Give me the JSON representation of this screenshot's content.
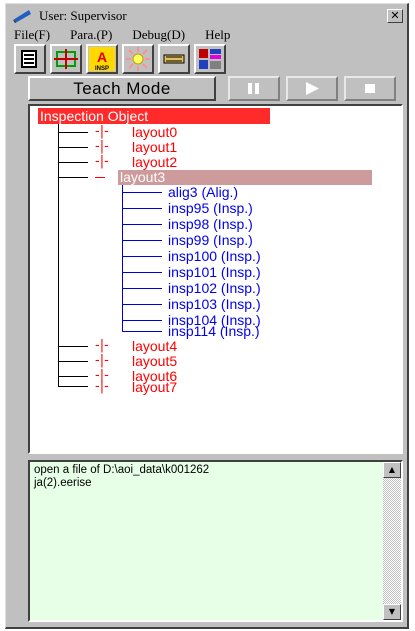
{
  "window": {
    "title": "User: Supervisor",
    "close_glyph": "✕"
  },
  "menu": [
    {
      "label": "File(F)"
    },
    {
      "label": "Para.(P)"
    },
    {
      "label": "Debug(D)"
    },
    {
      "label": "Help"
    }
  ],
  "toolbar": {
    "buttons": [
      {
        "icon": "document-list-icon"
      },
      {
        "icon": "grid-cross-icon"
      },
      {
        "icon": "insp-icon",
        "text": "INSP"
      },
      {
        "icon": "light-sun-icon"
      },
      {
        "icon": "chip-board-icon"
      },
      {
        "icon": "layout-blocks-icon"
      }
    ]
  },
  "teach": {
    "mode_label": "Teach Mode",
    "controls": [
      "pause-icon",
      "play-icon",
      "stop-icon"
    ]
  },
  "tree": {
    "root": "Inspection Object",
    "layouts_before": [
      "layout0",
      "layout1",
      "layout2"
    ],
    "selected": "layout3",
    "children": [
      "alig3 (Alig.)",
      "insp95 (Insp.)",
      "insp98 (Insp.)",
      "insp99 (Insp.)",
      "insp100 (Insp.)",
      "insp101 (Insp.)",
      "insp102 (Insp.)",
      "insp103 (Insp.)",
      "insp104 (Insp.)",
      "insp114 (Insp.)"
    ],
    "layouts_after": [
      "layout4",
      "layout5",
      "layout6",
      "layout7"
    ]
  },
  "log": {
    "lines": [
      "open a file of D:\\aoi_data\\k001262",
      "ja(2).eerise"
    ]
  },
  "colors": {
    "window": "#c0c0c0",
    "root_highlight": "#ff2a2a",
    "selected_highlight": "#cd9b9b",
    "tree_red": "#ff0000",
    "tree_blue": "#0000ee",
    "log_bg": "#e6ffe6"
  }
}
